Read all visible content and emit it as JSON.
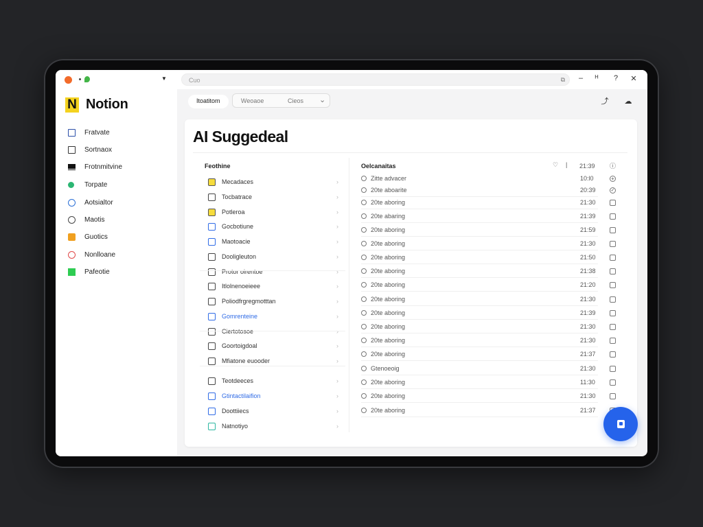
{
  "browser": {
    "url_placeholder": "Cuo",
    "url_action": "⧉",
    "window": {
      "minimize": "–",
      "restore": "ᴴ",
      "help": "?",
      "close": "✕"
    }
  },
  "app": {
    "logo_letter": "N",
    "name": "Notion"
  },
  "sidebar": {
    "items": [
      {
        "label": "Fratvate",
        "icon": "calendar-icon",
        "color": "#2a4ea8"
      },
      {
        "label": "Sortnaox",
        "icon": "square-icon",
        "color": "#333333"
      },
      {
        "label": "Frotnmitvine",
        "icon": "bar-icon",
        "color": "#111111"
      },
      {
        "label": "Torpate",
        "icon": "green-dot-icon",
        "color": "#2bb673"
      },
      {
        "label": "Aotsialtor",
        "icon": "person-icon",
        "color": "#2a6fd6"
      },
      {
        "label": "Maotis",
        "icon": "clock-icon",
        "color": "#444444"
      },
      {
        "label": "Guotics",
        "icon": "bag-icon",
        "color": "#f0a020"
      },
      {
        "label": "Nonlloane",
        "icon": "heart-icon",
        "color": "#e04848"
      },
      {
        "label": "Pafeotie",
        "icon": "green-square-icon",
        "color": "#2ecc52"
      }
    ]
  },
  "toolbar": {
    "tab_label": "Itoatitom",
    "filter_left": "Weoaoe",
    "filter_right": "Cieos",
    "filter_caret": "⌄"
  },
  "main": {
    "title": "AI Suggedeal",
    "left_header": "Feothine",
    "left_rows": [
      {
        "label": "Mecadaces",
        "accent": "yellow"
      },
      {
        "label": "Tocbatrace",
        "accent": "none"
      },
      {
        "label": "Potleroa",
        "accent": "yellow"
      },
      {
        "label": "Gocbotiune",
        "accent": "blue-outline"
      },
      {
        "label": "Maotoacie",
        "accent": "blue-outline"
      },
      {
        "label": "Dooligleuton",
        "accent": "none"
      },
      {
        "label": "Protor oirentoe",
        "accent": "none"
      },
      {
        "label": "Itlolnenoeieee",
        "accent": "none"
      },
      {
        "label": "Poliodfrgregmotttan",
        "accent": "none"
      },
      {
        "label": "Gomrenteine",
        "accent": "blue"
      },
      {
        "label": "Ciertotosoe",
        "accent": "none"
      },
      {
        "label": "Goortoigdoal",
        "accent": "none"
      },
      {
        "label": "Mfiatone euooder",
        "accent": "none"
      },
      {
        "label": "Teotdeeces",
        "accent": "none"
      },
      {
        "label": "Gtintactilaifion",
        "accent": "blue"
      },
      {
        "label": "Doottiiecs",
        "accent": "blue-outline"
      },
      {
        "label": "Natnotiyo",
        "accent": "teal"
      }
    ],
    "right_header": "Oelcanaitas",
    "right_header_time": "21:39",
    "right_rows": [
      {
        "label": "Zitte advacer",
        "time": "10:l0",
        "mark": "plus"
      },
      {
        "label": "20te aboarite",
        "time": "20:39",
        "mark": "check"
      },
      {
        "label": "20te aboring",
        "time": "21:30",
        "mark": "box"
      },
      {
        "label": "20te abaring",
        "time": "21:39",
        "mark": "box"
      },
      {
        "label": "20te aboring",
        "time": "21:59",
        "mark": "box"
      },
      {
        "label": "20te aboring",
        "time": "21:30",
        "mark": "box"
      },
      {
        "label": "20te aboring",
        "time": "21:50",
        "mark": "box"
      },
      {
        "label": "20te aboring",
        "time": "21:38",
        "mark": "box"
      },
      {
        "label": "20te aboring",
        "time": "21:20",
        "mark": "box"
      },
      {
        "label": "20te aboring",
        "time": "21:30",
        "mark": "box"
      },
      {
        "label": "20te aboring",
        "time": "21:39",
        "mark": "box"
      },
      {
        "label": "20te aboring",
        "time": "21:30",
        "mark": "box"
      },
      {
        "label": "20te aboring",
        "time": "21:30",
        "mark": "box"
      },
      {
        "label": "20te aboring",
        "time": "21:37",
        "mark": "box"
      },
      {
        "label": "Gtenoeoig",
        "time": "21:30",
        "mark": "box"
      },
      {
        "label": "20te aboring",
        "time": "11:30",
        "mark": "box"
      },
      {
        "label": "20te aboring",
        "time": "21:30",
        "mark": "box"
      },
      {
        "label": "20te aboring",
        "time": "21:37",
        "mark": "box"
      }
    ]
  },
  "colors": {
    "accent": "#2563eb",
    "logo": "#f4d21f"
  }
}
